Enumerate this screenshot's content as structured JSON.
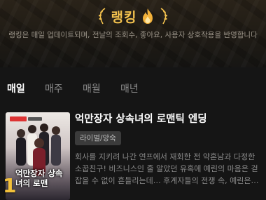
{
  "hero": {
    "title": "랭킹",
    "description": "랭킹은 매일 업데이트되며, 전날의 조회수, 좋아요, 사용자 상호작용을 반영합니다"
  },
  "tabs": [
    {
      "label": "매일",
      "active": true
    },
    {
      "label": "매주",
      "active": false
    },
    {
      "label": "매월",
      "active": false
    },
    {
      "label": "매년",
      "active": false
    }
  ],
  "items": [
    {
      "rank": "1",
      "cover_title": "억만장자 상속녀의 로맨",
      "title": "억만장자 상속녀의 로맨틱 엔딩",
      "genre": "라이벌/앙숙",
      "summary": "회사를 지키려 나간 연프에서 재회한 전 약혼남과 다정한 소꿉친구! 비즈니스인 줄 알았던 유혹에 예린의 마음은 걷잡을 수 없이 흔들리는데… 후계자들의 전쟁 속, 예린은…"
    }
  ],
  "colors": {
    "accent_gold": "#f2c14e",
    "background": "#151515",
    "tab_active": "#ffffff",
    "tab_inactive": "#8a8a8a"
  }
}
